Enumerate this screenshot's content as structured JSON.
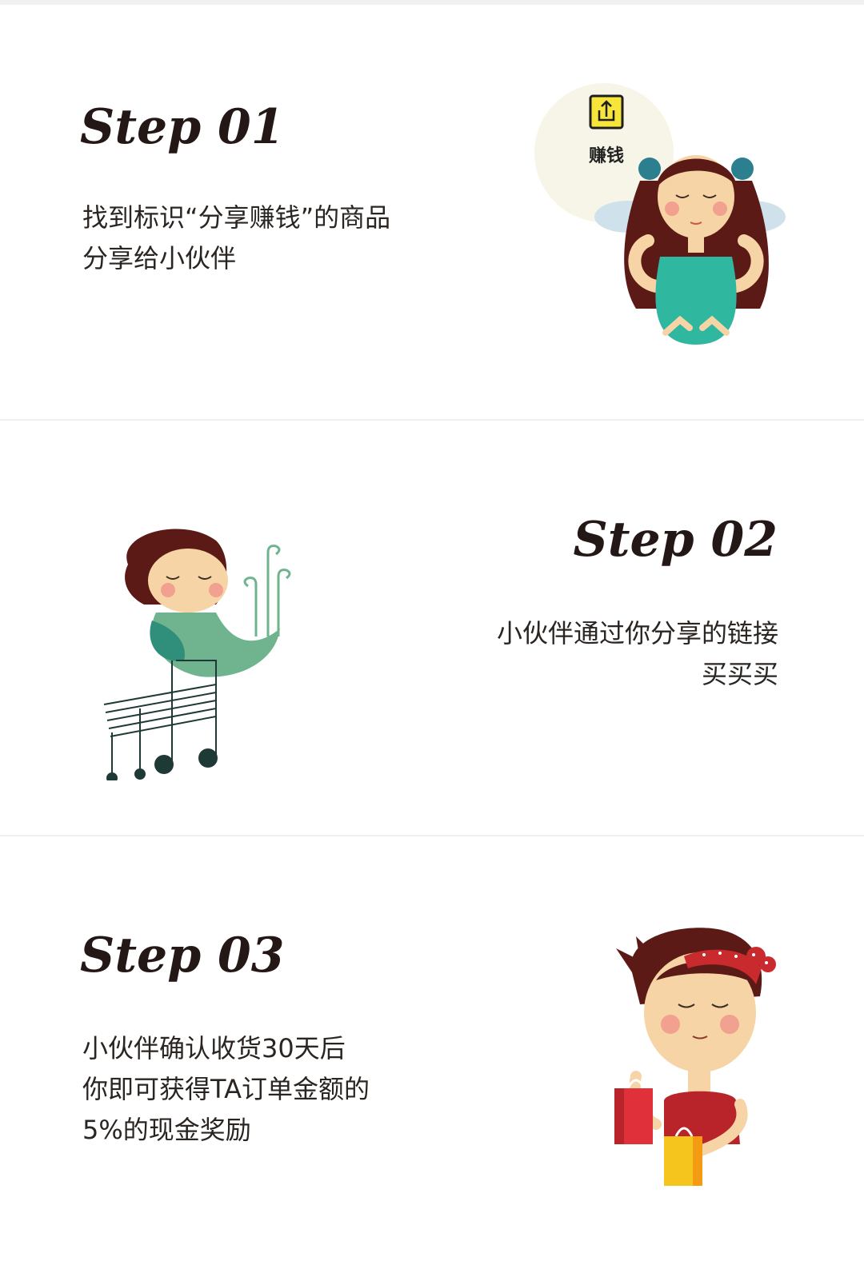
{
  "steps": [
    {
      "title": "Step 01",
      "lines": [
        "找到标识“分享赚钱”的商品",
        "分享给小伙伴"
      ],
      "badge_label": "赚钱",
      "illustration": "meditating-angel-girl"
    },
    {
      "title": "Step 02",
      "lines": [
        "小伙伴通过你分享的链接",
        "买买买"
      ],
      "illustration": "music-note-cart-girl"
    },
    {
      "title": "Step 03",
      "lines": [
        "小伙伴确认收货30天后",
        "你即可获得TA订单金额的",
        "5%的现金奖励"
      ],
      "illustration": "shopping-bags-girl"
    }
  ],
  "colors": {
    "title": "#231815",
    "text": "#2b2522",
    "divider": "#f0f0f0",
    "badge_yellow": "#f7e53b",
    "hair": "#5c1a16",
    "skin": "#f7d4a6",
    "teal": "#2fb7a0",
    "green": "#6fb48e",
    "red": "#c92a2e"
  },
  "icons": [
    "share-icon"
  ]
}
